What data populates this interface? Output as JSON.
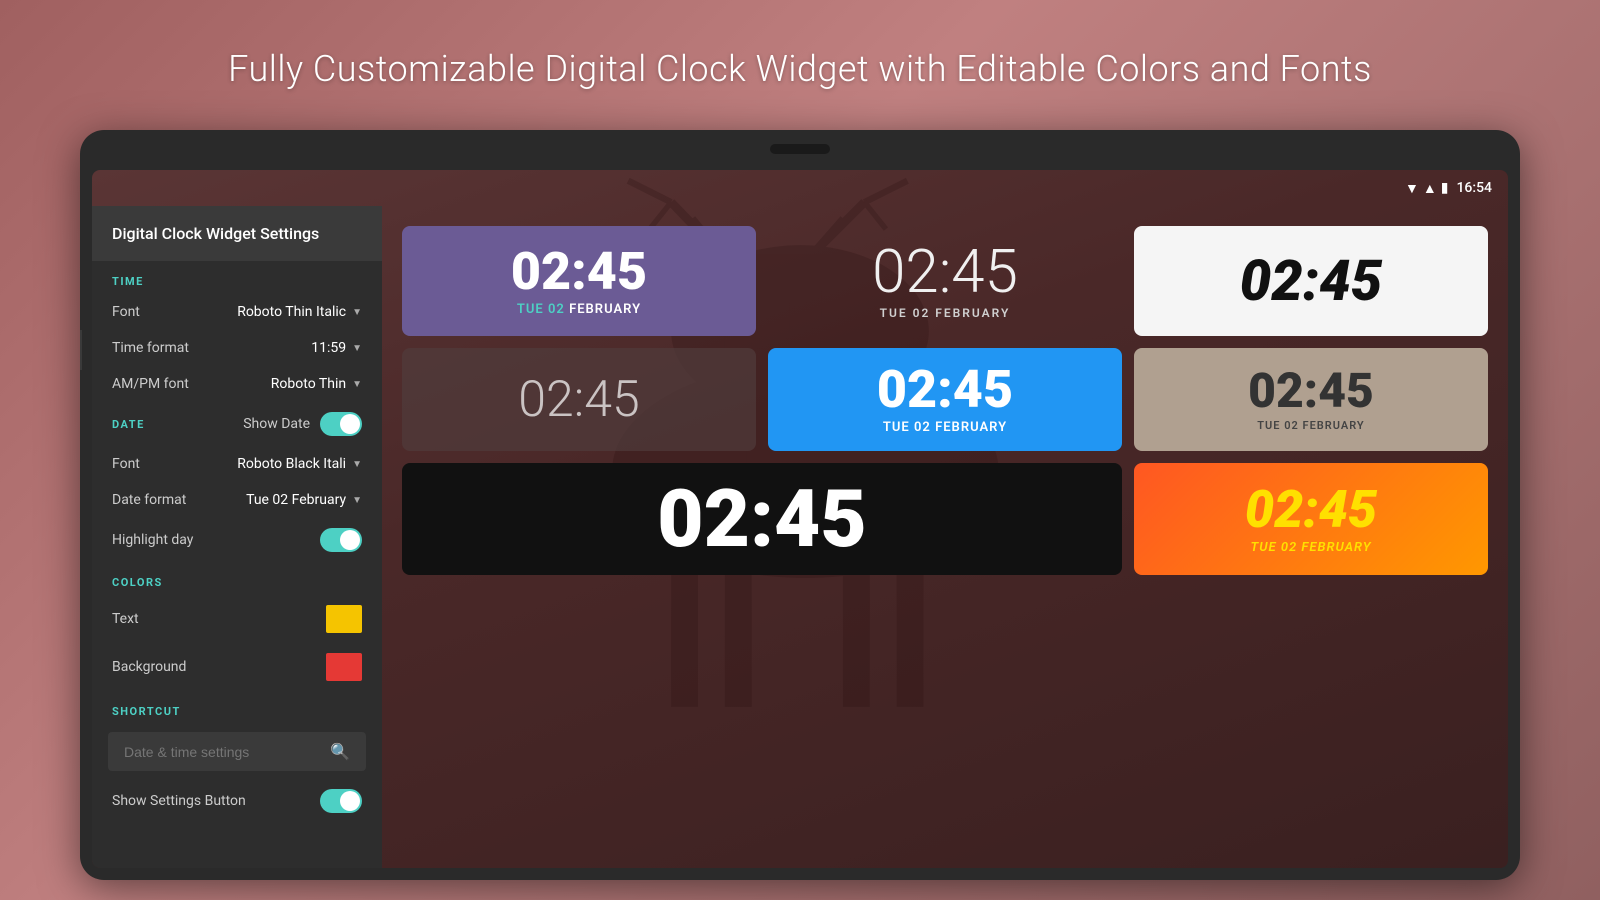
{
  "headline": "Fully Customizable Digital Clock Widget with Editable Colors and Fonts",
  "status_bar": {
    "time": "16:54",
    "wifi_icon": "▼",
    "signal_icon": "▲",
    "battery_icon": "🔋"
  },
  "settings": {
    "title": "Digital Clock Widget Settings",
    "sections": {
      "time": {
        "header": "TIME",
        "rows": [
          {
            "label": "Font",
            "value": "Roboto Thin Italic"
          },
          {
            "label": "Time format",
            "value": "11:59"
          },
          {
            "label": "AM/PM font",
            "value": "Roboto Thin"
          }
        ]
      },
      "date": {
        "header": "DATE",
        "show_date_label": "Show Date",
        "toggle_on": true,
        "rows": [
          {
            "label": "Font",
            "value": "Roboto Black Itali"
          },
          {
            "label": "Date format",
            "value": "Tue 02 February"
          },
          {
            "label": "Highlight day",
            "value": ""
          }
        ]
      },
      "colors": {
        "header": "COLORS",
        "rows": [
          {
            "label": "Text",
            "color": "#f5c400"
          },
          {
            "label": "Background",
            "color": "#e53935"
          }
        ]
      },
      "shortcut": {
        "header": "SHORTCUT",
        "search_placeholder": "Date & time settings",
        "show_settings_button_label": "Show Settings Button",
        "show_settings_toggle": true
      }
    }
  },
  "widgets": [
    {
      "id": "purple",
      "time": "02:45",
      "date": "TUE 02 FEBRUARY",
      "style": "purple"
    },
    {
      "id": "plain-dark",
      "time": "02:45",
      "date": "TUE 02 FEBRUARY",
      "style": "plain-dark"
    },
    {
      "id": "white",
      "time": "02:45",
      "date": "",
      "style": "white"
    },
    {
      "id": "semi-dark",
      "time": "02:45",
      "date": "",
      "style": "semi-dark"
    },
    {
      "id": "blue",
      "time": "02:45",
      "date": "TUE 02 FEBRUARY",
      "style": "blue"
    },
    {
      "id": "tan",
      "time": "02:45",
      "date": "TUE 02 FEBRUARY",
      "style": "tan"
    },
    {
      "id": "black-large",
      "time": "02:45",
      "date": "",
      "style": "black-large"
    },
    {
      "id": "red",
      "time": "02:45",
      "date": "TUE 02 FEBRUARY",
      "style": "red"
    }
  ]
}
